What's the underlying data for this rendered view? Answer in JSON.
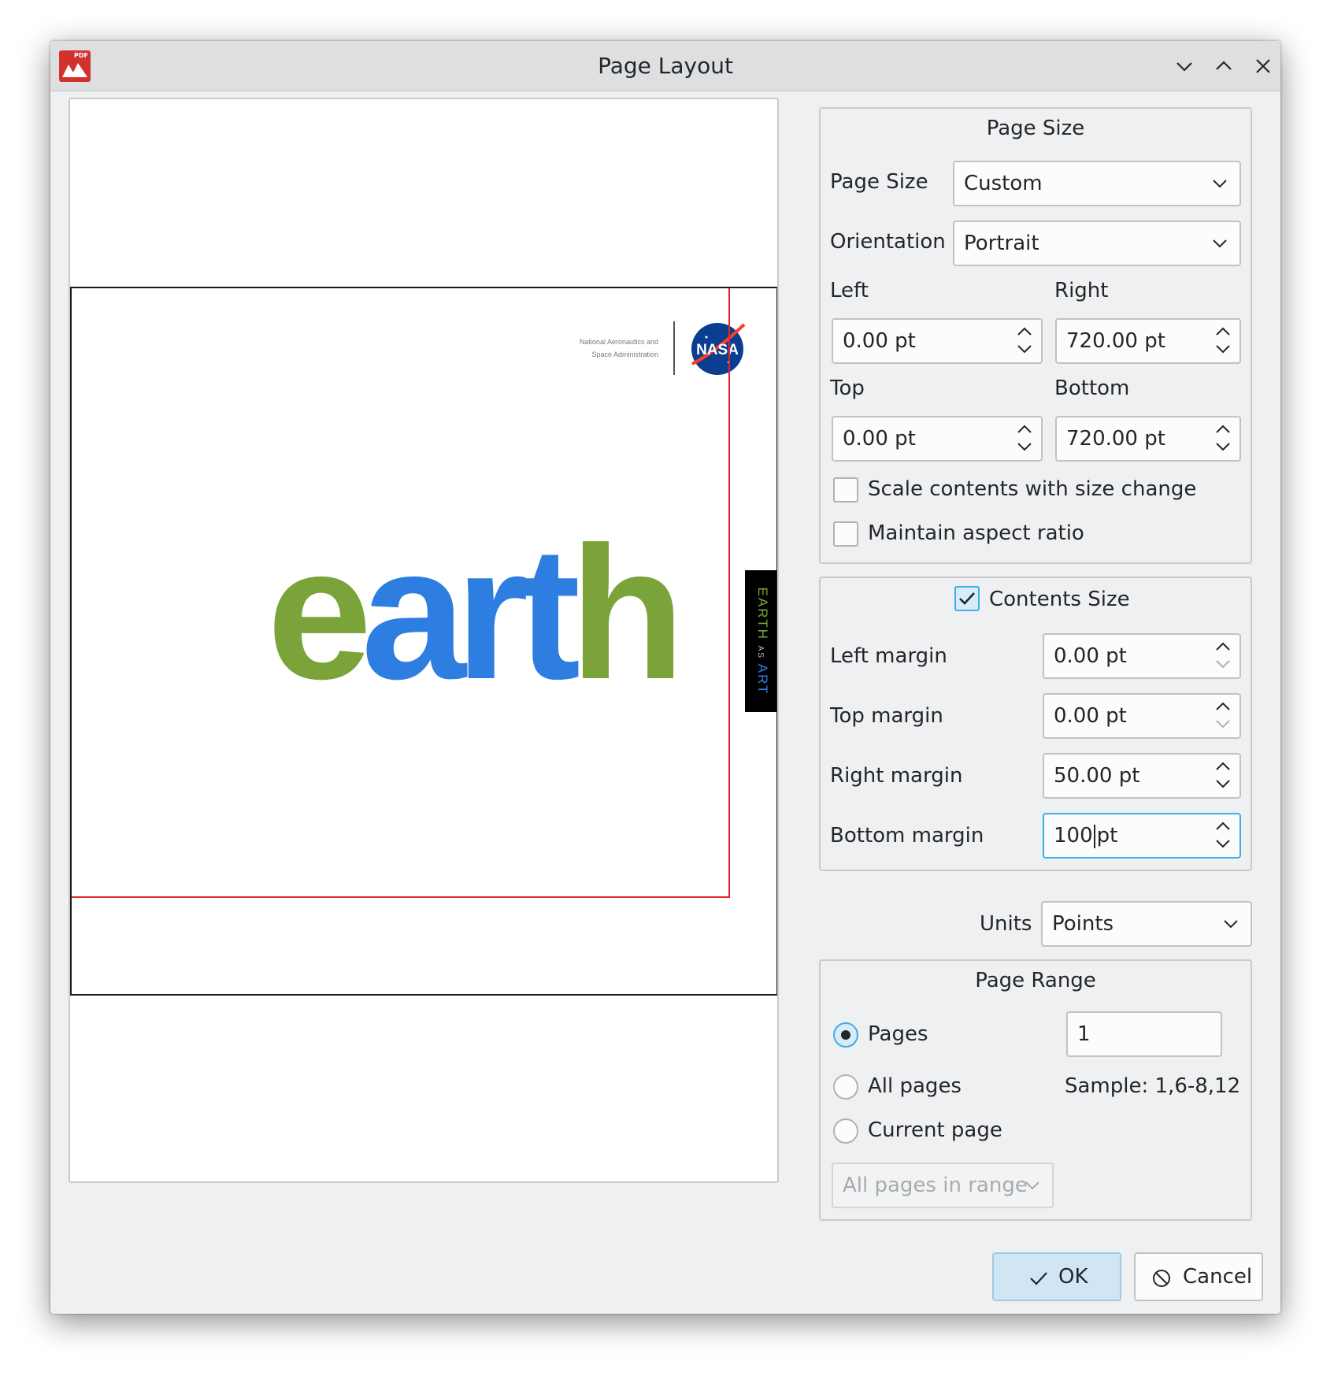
{
  "window": {
    "title": "Page Layout",
    "app_icon_text": "PDF"
  },
  "preview": {
    "nasa_text_line1": "National Aeronautics and",
    "nasa_text_line2": "Space Administration",
    "nasa_logo_text": "NASA",
    "earth_word": {
      "part1": "e",
      "part2": "art",
      "part3": "h"
    },
    "side_banner": {
      "part1": "EARTH",
      "part2": "AS",
      "part3": "ART"
    },
    "colors": {
      "red_margin": "#e0262a",
      "earth_green": "#7aa33a",
      "earth_blue": "#2e7de0"
    }
  },
  "page_size_group": {
    "title": "Page Size",
    "page_size_label": "Page Size",
    "page_size_value": "Custom",
    "orientation_label": "Orientation",
    "orientation_value": "Portrait",
    "left_label": "Left",
    "left_value": "0.00 pt",
    "right_label": "Right",
    "right_value": "720.00 pt",
    "top_label": "Top",
    "top_value": "0.00 pt",
    "bottom_label": "Bottom",
    "bottom_value": "720.00 pt",
    "scale_label": "Scale contents with size change",
    "scale_checked": false,
    "aspect_label": "Maintain aspect ratio",
    "aspect_checked": false
  },
  "contents_size_group": {
    "title": "Contents Size",
    "checked": true,
    "left_margin_label": "Left margin",
    "left_margin_value": "0.00 pt",
    "top_margin_label": "Top margin",
    "top_margin_value": "0.00 pt",
    "right_margin_label": "Right margin",
    "right_margin_value": "50.00 pt",
    "bottom_margin_label": "Bottom margin",
    "bottom_margin_value_number": "100",
    "bottom_margin_value_unit": "pt"
  },
  "units": {
    "label": "Units",
    "value": "Points"
  },
  "page_range_group": {
    "title": "Page Range",
    "pages_label": "Pages",
    "pages_value": "1",
    "all_pages_label": "All pages",
    "sample_text": "Sample: 1,6-8,12",
    "current_page_label": "Current page",
    "subset_value": "All pages in range",
    "selected": "pages"
  },
  "buttons": {
    "ok_label": "OK",
    "cancel_label": "Cancel"
  }
}
